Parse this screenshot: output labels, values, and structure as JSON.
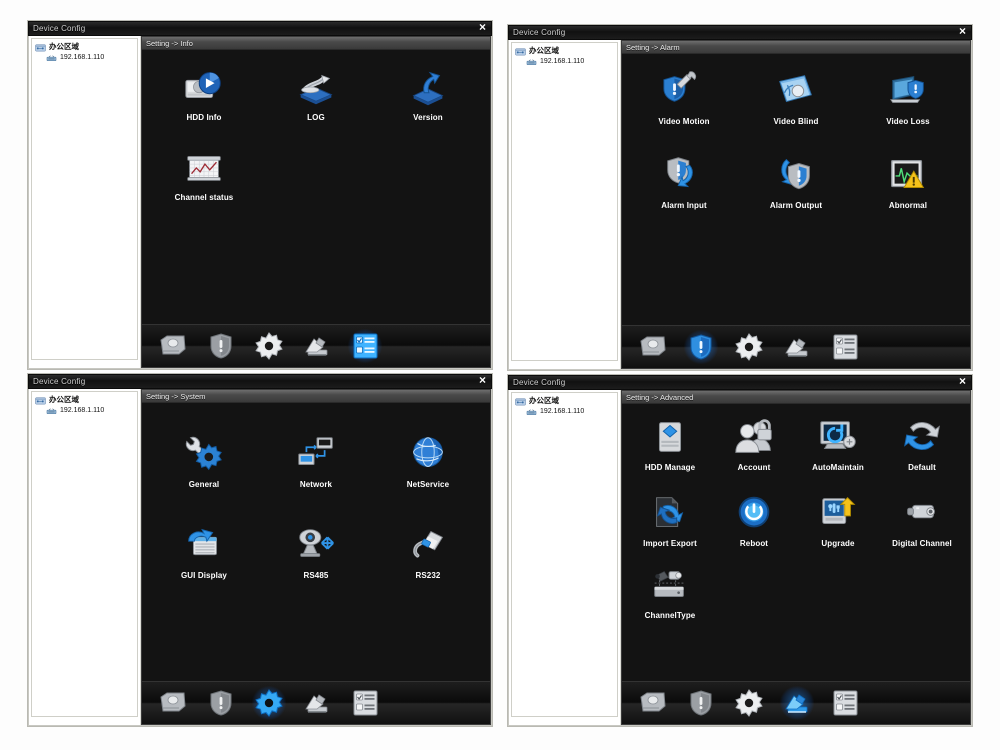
{
  "window": {
    "title": "Device Config",
    "close_label": "×"
  },
  "tree": {
    "root_label": "办公区域",
    "child_label": "192.168.1.110",
    "root_icon": "folder-network-icon",
    "child_icon": "device-icon"
  },
  "colors": {
    "panel_bg": "#131313",
    "header_gradient_top": "#6e6e6e",
    "accent_blue": "#2aa0ff",
    "label_text": "#ffffff",
    "titlebar_bg": "#111111"
  },
  "toolbar": {
    "items": [
      {
        "name": "hdd-icon",
        "label": "HDD"
      },
      {
        "name": "shield-icon",
        "label": "Alarm"
      },
      {
        "name": "gear-icon",
        "label": "System"
      },
      {
        "name": "tools-icon",
        "label": "Advanced"
      },
      {
        "name": "list-icon",
        "label": "Info"
      }
    ]
  },
  "panels": [
    {
      "id": "info",
      "header": "Setting -> Info",
      "active_toolbar_index": 4,
      "columns": 3,
      "items": [
        {
          "label": "HDD Info",
          "icon": "hdd-info-icon"
        },
        {
          "label": "LOG",
          "icon": "log-icon"
        },
        {
          "label": "Version",
          "icon": "version-icon"
        },
        {
          "label": "Channel status",
          "icon": "channel-status-icon"
        }
      ]
    },
    {
      "id": "alarm",
      "header": "Setting -> Alarm",
      "active_toolbar_index": 1,
      "columns": 3,
      "items": [
        {
          "label": "Video Motion",
          "icon": "video-motion-icon"
        },
        {
          "label": "Video Blind",
          "icon": "video-blind-icon"
        },
        {
          "label": "Video Loss",
          "icon": "video-loss-icon"
        },
        {
          "label": "Alarm Input",
          "icon": "alarm-input-icon"
        },
        {
          "label": "Alarm Output",
          "icon": "alarm-output-icon"
        },
        {
          "label": "Abnormal",
          "icon": "abnormal-icon"
        }
      ]
    },
    {
      "id": "system",
      "header": "Setting -> System",
      "active_toolbar_index": 2,
      "columns": 3,
      "items": [
        {
          "label": "General",
          "icon": "general-icon"
        },
        {
          "label": "Network",
          "icon": "network-icon"
        },
        {
          "label": "NetService",
          "icon": "netservice-icon"
        },
        {
          "label": "GUI Display",
          "icon": "gui-display-icon"
        },
        {
          "label": "RS485",
          "icon": "rs485-icon"
        },
        {
          "label": "RS232",
          "icon": "rs232-icon"
        }
      ]
    },
    {
      "id": "advanced",
      "header": "Setting -> Advanced",
      "active_toolbar_index": 3,
      "columns": 4,
      "items": [
        {
          "label": "HDD Manage",
          "icon": "hdd-manage-icon"
        },
        {
          "label": "Account",
          "icon": "account-icon"
        },
        {
          "label": "AutoMaintain",
          "icon": "automaintain-icon"
        },
        {
          "label": "Default",
          "icon": "default-icon"
        },
        {
          "label": "Import Export",
          "icon": "import-export-icon"
        },
        {
          "label": "Reboot",
          "icon": "reboot-icon"
        },
        {
          "label": "Upgrade",
          "icon": "upgrade-icon"
        },
        {
          "label": "Digital Channel",
          "icon": "digital-channel-icon"
        },
        {
          "label": "ChannelType",
          "icon": "channel-type-icon"
        }
      ]
    }
  ]
}
